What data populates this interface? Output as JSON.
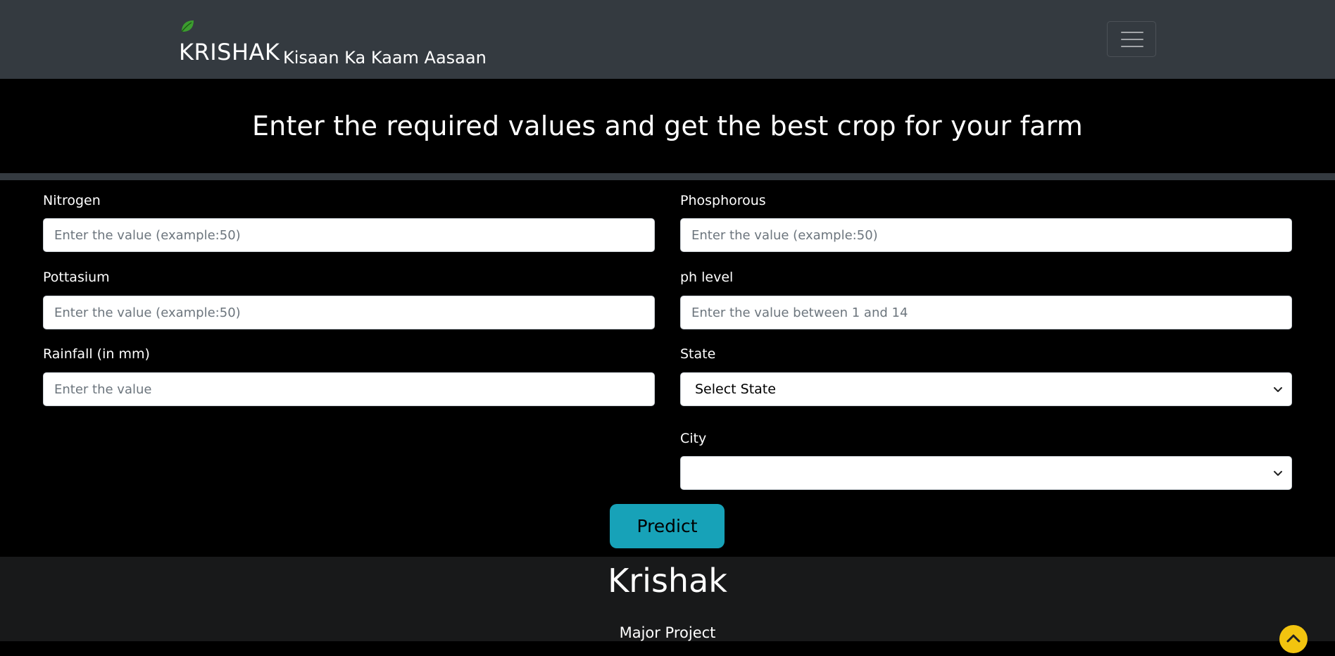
{
  "navbar": {
    "brand_name": "KRISHAK",
    "tagline": "Kisaan Ka Kaam Aasaan",
    "leaf_icon": "leaf-icon",
    "menu_icon": "hamburger-icon"
  },
  "heading": {
    "title": "Enter the required values and get the best crop for your farm"
  },
  "form": {
    "nitrogen": {
      "label": "Nitrogen",
      "placeholder": "Enter the value (example:50)",
      "value": ""
    },
    "phosphorous": {
      "label": "Phosphorous",
      "placeholder": "Enter the value (example:50)",
      "value": ""
    },
    "pottasium": {
      "label": "Pottasium",
      "placeholder": "Enter the value (example:50)",
      "value": ""
    },
    "ph": {
      "label": "ph level",
      "placeholder": "Enter the value between 1 and 14",
      "value": ""
    },
    "rainfall": {
      "label": "Rainfall (in mm)",
      "placeholder": "Enter the value",
      "value": ""
    },
    "state": {
      "label": "State",
      "selected": "Select State"
    },
    "city": {
      "label": "City",
      "selected": ""
    },
    "predict_label": "Predict"
  },
  "footer": {
    "title": "Krishak",
    "subtitle": "Major Project"
  },
  "colors": {
    "navbar_bg": "#343a40",
    "page_bg": "#000000",
    "accent": "#17a2b8",
    "footer_bg": "#18191a",
    "scroll_top": "#f2c40f"
  }
}
